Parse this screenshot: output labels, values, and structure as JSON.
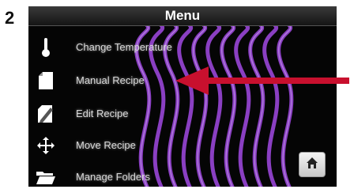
{
  "step": {
    "number": "2"
  },
  "header": {
    "title": "Menu"
  },
  "menu": {
    "items": [
      {
        "label": "Change Temperature",
        "icon": "thermometer-icon"
      },
      {
        "label": "Manual Recipe",
        "icon": "document-icon"
      },
      {
        "label": "Edit Recipe",
        "icon": "edit-document-icon"
      },
      {
        "label": "Move Recipe",
        "icon": "move-arrows-icon"
      },
      {
        "label": "Manage Folders",
        "icon": "folder-icon"
      }
    ]
  },
  "home": {
    "icon": "home-icon"
  },
  "annotation": {
    "arrow_color": "#c8102e",
    "points_to": "Manual Recipe"
  },
  "colors": {
    "screen_bg": "#050505",
    "wave": "#8a3fc2",
    "text": "#d8d8d8"
  }
}
